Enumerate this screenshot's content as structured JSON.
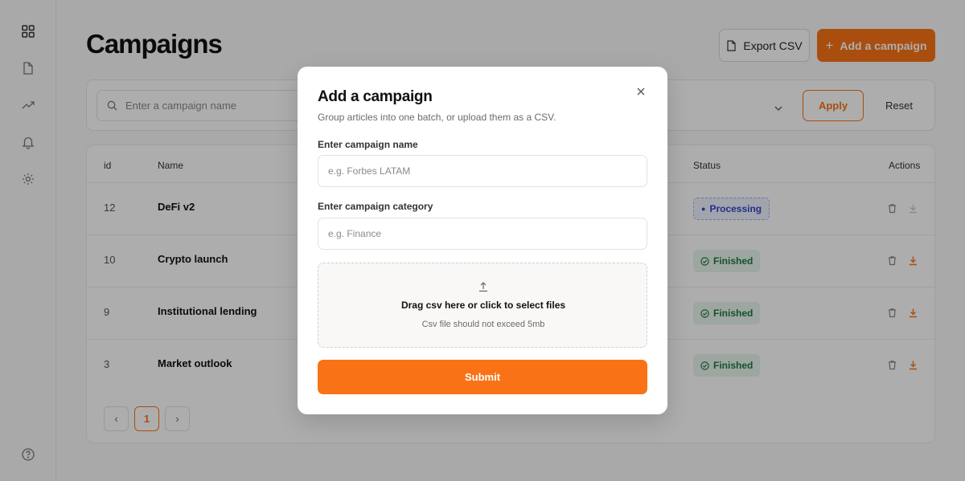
{
  "page": {
    "title": "Campaigns"
  },
  "header": {
    "export_label": "Export CSV",
    "add_label": "Add a campaign"
  },
  "filters": {
    "search_placeholder": "Enter a campaign name",
    "apply_label": "Apply",
    "reset_label": "Reset"
  },
  "table": {
    "headers": {
      "id": "id",
      "name": "Name",
      "status": "Status",
      "actions": "Actions"
    },
    "rows": [
      {
        "id": "12",
        "name": "DeFi v2",
        "status": "Processing",
        "status_kind": "processing",
        "download_enabled": false
      },
      {
        "id": "10",
        "name": "Crypto launch",
        "status": "Finished",
        "status_kind": "finished",
        "download_enabled": true
      },
      {
        "id": "9",
        "name": "Institutional lending",
        "status": "Finished",
        "status_kind": "finished",
        "download_enabled": true
      },
      {
        "id": "3",
        "name": "Market outlook",
        "status": "Finished",
        "status_kind": "finished",
        "download_enabled": true
      }
    ]
  },
  "pagination": {
    "prev": "‹",
    "current": "1",
    "next": "›"
  },
  "modal": {
    "title": "Add a campaign",
    "subtitle": "Group articles into one batch, or upload them as a CSV.",
    "name_label": "Enter campaign name",
    "name_placeholder": "e.g. Forbes LATAM",
    "category_label": "Enter campaign category",
    "category_placeholder": "e.g. Finance",
    "dropzone_title": "Drag csv here or click to select files",
    "dropzone_hint": "Csv file should not exceed 5mb",
    "submit_label": "Submit"
  },
  "colors": {
    "accent": "#f97316",
    "processing": "#3346c8",
    "finished": "#1f7a45"
  },
  "icons": {
    "sidebar": [
      "grid-icon",
      "document-icon",
      "trend-icon",
      "bell-icon",
      "gear-icon",
      "help-icon"
    ],
    "actions": [
      "trash-icon",
      "download-icon"
    ]
  }
}
